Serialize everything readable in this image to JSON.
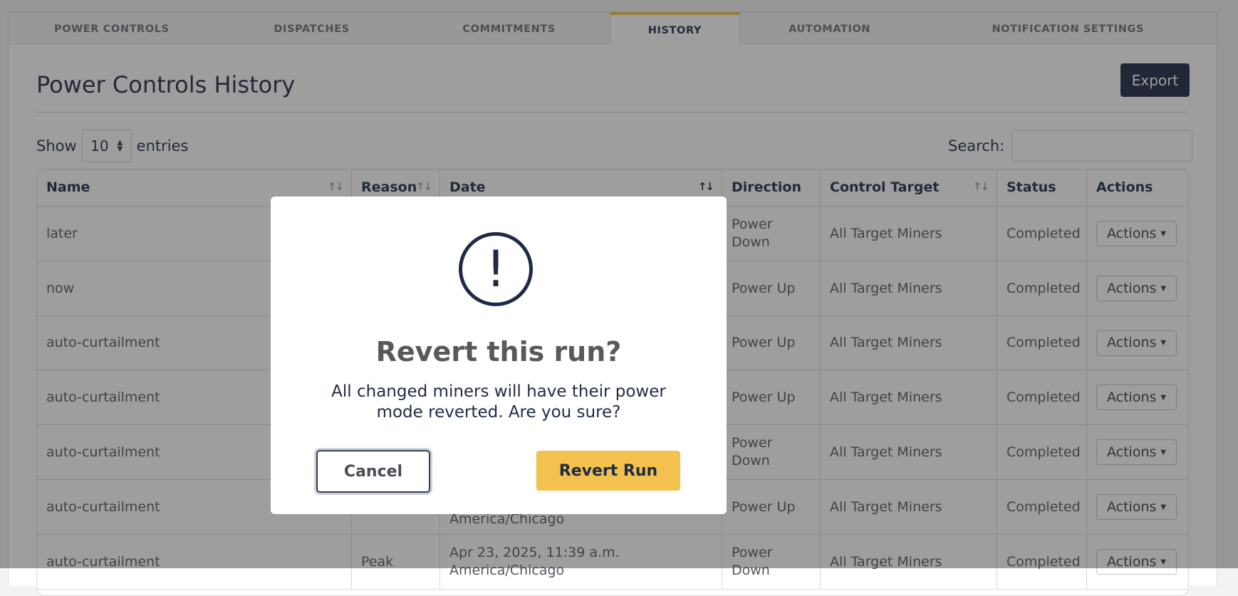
{
  "tabs": [
    {
      "label": "POWER CONTROLS"
    },
    {
      "label": "DISPATCHES"
    },
    {
      "label": "COMMITMENTS"
    },
    {
      "label": "HISTORY"
    },
    {
      "label": "AUTOMATION"
    },
    {
      "label": "NOTIFICATION SETTINGS"
    }
  ],
  "page": {
    "title": "Power Controls History",
    "export_label": "Export",
    "show_label": "Show",
    "entries_value": "10",
    "entries_label": "entries",
    "search_label": "Search:",
    "search_value": ""
  },
  "table": {
    "headers": [
      "Name",
      "Reason",
      "Date",
      "Direction",
      "Control Target",
      "Status",
      "Actions"
    ],
    "rows": [
      {
        "name": "later",
        "reason": "",
        "date": "",
        "direction": "Power Down",
        "target": "All Target Miners",
        "status": "Completed",
        "action": "Actions"
      },
      {
        "name": "now",
        "reason": "",
        "date": "",
        "direction": "Power Up",
        "target": "All Target Miners",
        "status": "Completed",
        "action": "Actions"
      },
      {
        "name": "auto-curtailment",
        "reason": "",
        "date": "",
        "direction": "Power Up",
        "target": "All Target Miners",
        "status": "Completed",
        "action": "Actions"
      },
      {
        "name": "auto-curtailment",
        "reason": "",
        "date": "",
        "direction": "Power Up",
        "target": "All Target Miners",
        "status": "Completed",
        "action": "Actions"
      },
      {
        "name": "auto-curtailment",
        "reason": "",
        "date": "",
        "direction": "Power Down",
        "target": "All Target Miners",
        "status": "Completed",
        "action": "Actions"
      },
      {
        "name": "auto-curtailment",
        "reason": "",
        "date": "America/Chicago",
        "direction": "Power Up",
        "target": "All Target Miners",
        "status": "Completed",
        "action": "Actions"
      },
      {
        "name": "auto-curtailment",
        "reason": "Peak",
        "date": "Apr 23, 2025, 11:39 a.m. America/Chicago",
        "direction": "Power Down",
        "target": "All Target Miners",
        "status": "Completed",
        "action": "Actions"
      }
    ]
  },
  "modal": {
    "icon": "exclamation-circle-icon",
    "title": "Revert this run?",
    "text": "All changed miners will have their power mode reverted. Are you sure?",
    "cancel_label": "Cancel",
    "confirm_label": "Revert Run"
  },
  "colors": {
    "accent": "#f2c14e",
    "navy": "#1d2742"
  }
}
